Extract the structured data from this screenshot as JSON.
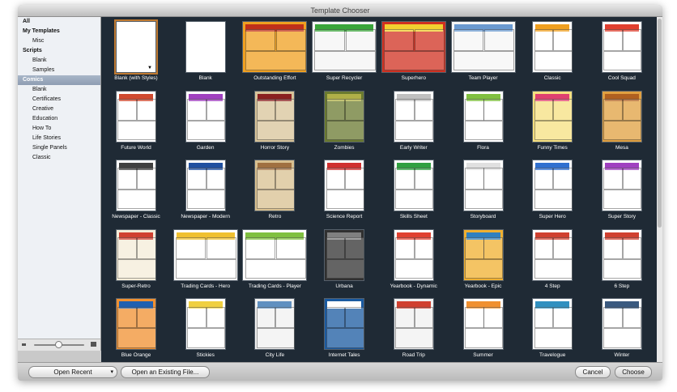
{
  "window": {
    "title": "Template Chooser"
  },
  "sidebar": {
    "items": [
      {
        "label": "All",
        "kind": "head"
      },
      {
        "label": "My Templates",
        "kind": "head"
      },
      {
        "label": "Misc",
        "kind": "sub"
      },
      {
        "label": "Scripts",
        "kind": "head"
      },
      {
        "label": "Blank",
        "kind": "sub"
      },
      {
        "label": "Samples",
        "kind": "sub"
      },
      {
        "label": "Comics",
        "kind": "sel"
      },
      {
        "label": "Blank",
        "kind": "sub"
      },
      {
        "label": "Certificates",
        "kind": "sub"
      },
      {
        "label": "Creative",
        "kind": "sub"
      },
      {
        "label": "Education",
        "kind": "sub"
      },
      {
        "label": "How To",
        "kind": "sub"
      },
      {
        "label": "Life Stories",
        "kind": "sub"
      },
      {
        "label": "Single Panels",
        "kind": "sub"
      },
      {
        "label": "Classic",
        "kind": "sub"
      }
    ],
    "zoom_small_icon": "small-page-icon",
    "zoom_large_icon": "large-page-icon"
  },
  "templates": [
    {
      "name": "Blank (with Styles)",
      "bg": "#ffffff",
      "accent": "#ffffff",
      "selected": true
    },
    {
      "name": "Blank",
      "bg": "#ffffff",
      "accent": "#ffffff"
    },
    {
      "name": "Outstanding Effort",
      "bg": "#f0a020",
      "accent": "#c0301a",
      "wide": true
    },
    {
      "name": "Super Recycler",
      "bg": "#f4f4f4",
      "accent": "#3aa53a",
      "wide": true
    },
    {
      "name": "Superhero",
      "bg": "#d03020",
      "accent": "#f2d030",
      "wide": true
    },
    {
      "name": "Team Player",
      "bg": "#f6f6f6",
      "accent": "#6a9ad0",
      "wide": true
    },
    {
      "name": "Classic",
      "bg": "#ffffff",
      "accent": "#f0a020"
    },
    {
      "name": "Cool Squad",
      "bg": "#ffffff",
      "accent": "#e04030"
    },
    {
      "name": "Future World",
      "bg": "#ffffff",
      "accent": "#d04a30"
    },
    {
      "name": "Garden",
      "bg": "#ffffff",
      "accent": "#a040c0"
    },
    {
      "name": "Horror Story",
      "bg": "#d8c49a",
      "accent": "#8a2020"
    },
    {
      "name": "Zombies",
      "bg": "#6a7a30",
      "accent": "#b0b048"
    },
    {
      "name": "Early Writer",
      "bg": "#ffffff",
      "accent": "#c0c0c0"
    },
    {
      "name": "Flora",
      "bg": "#ffffff",
      "accent": "#80c040"
    },
    {
      "name": "Funny Times",
      "bg": "#f6e080",
      "accent": "#e04070"
    },
    {
      "name": "Mesa",
      "bg": "#e0a040",
      "accent": "#b06020"
    },
    {
      "name": "Newspaper - Classic",
      "bg": "#ffffff",
      "accent": "#404040"
    },
    {
      "name": "Newspaper - Modern",
      "bg": "#ffffff",
      "accent": "#2050a0"
    },
    {
      "name": "Retro",
      "bg": "#d8c090",
      "accent": "#a07040"
    },
    {
      "name": "Science Report",
      "bg": "#ffffff",
      "accent": "#d03030"
    },
    {
      "name": "Skills Sheet",
      "bg": "#ffffff",
      "accent": "#30a040"
    },
    {
      "name": "Storyboard",
      "bg": "#ffffff",
      "accent": "#e0e0e0"
    },
    {
      "name": "Super Hero",
      "bg": "#ffffff",
      "accent": "#3070d0"
    },
    {
      "name": "Super Story",
      "bg": "#ffffff",
      "accent": "#a040c0"
    },
    {
      "name": "Super-Retro",
      "bg": "#f4ecd8",
      "accent": "#d04030"
    },
    {
      "name": "Trading Cards - Hero",
      "bg": "#ffffff",
      "accent": "#f0c030",
      "wide": true
    },
    {
      "name": "Trading Cards - Player",
      "bg": "#ffffff",
      "accent": "#80c040",
      "wide": true
    },
    {
      "name": "Urbana",
      "bg": "#303030",
      "accent": "#808080"
    },
    {
      "name": "Yearbook - Dynamic",
      "bg": "#ffffff",
      "accent": "#e04030"
    },
    {
      "name": "Yearbook - Epic",
      "bg": "#f0b030",
      "accent": "#3080c0"
    },
    {
      "name": "4 Step",
      "bg": "#ffffff",
      "accent": "#d04030"
    },
    {
      "name": "6 Step",
      "bg": "#ffffff",
      "accent": "#d04030"
    },
    {
      "name": "Blue Orange",
      "bg": "#f09030",
      "accent": "#2060b0"
    },
    {
      "name": "Stickies",
      "bg": "#ffffff",
      "accent": "#f0d040"
    },
    {
      "name": "City Life",
      "bg": "#f0f0f0",
      "accent": "#6090c0"
    },
    {
      "name": "Internet Tales",
      "bg": "#1a5aa0",
      "accent": "#ffffff"
    },
    {
      "name": "Road Trip",
      "bg": "#f0f0f0",
      "accent": "#d04030"
    },
    {
      "name": "Summer",
      "bg": "#ffffff",
      "accent": "#f09030"
    },
    {
      "name": "Travelogue",
      "bg": "#ffffff",
      "accent": "#3090c0"
    },
    {
      "name": "Winter",
      "bg": "#ffffff",
      "accent": "#3a5a80"
    }
  ],
  "footer": {
    "open_recent": "Open Recent",
    "open_existing": "Open an Existing File...",
    "cancel": "Cancel",
    "choose": "Choose"
  }
}
